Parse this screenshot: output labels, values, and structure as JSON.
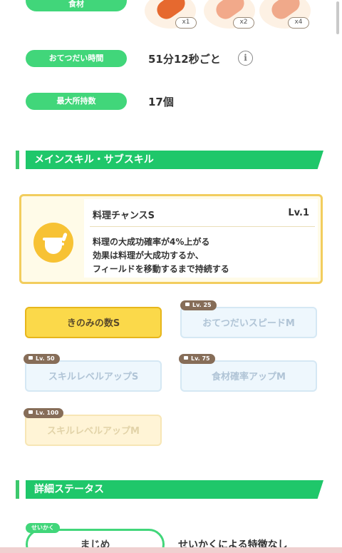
{
  "ingredients": {
    "label": "食材",
    "items": [
      {
        "icon": "sausage-icon",
        "count": "x1",
        "color": "#e6692f"
      },
      {
        "icon": "sausage-icon",
        "count": "x2",
        "color": "#f2a98a"
      },
      {
        "icon": "sausage-icon",
        "count": "x4",
        "color": "#f0a98a"
      }
    ]
  },
  "stats": {
    "help_interval_label": "おてつだい時間",
    "help_interval_value": "51分12秒ごと",
    "max_carry_label": "最大所持数",
    "max_carry_value": "17個"
  },
  "main_skill_section": {
    "title": "メインスキル・サブスキル"
  },
  "main_skill": {
    "icon": "cooking-pot-icon",
    "name": "料理チャンスS",
    "level": "Lv.1",
    "description_lines": [
      "料理の大成功確率が4%上がる",
      "効果は料理が大成功するか、",
      "フィールドを移動するまで持続する"
    ]
  },
  "sub_skills": [
    {
      "label": "きのみの数S",
      "lock": "",
      "state": "active"
    },
    {
      "label": "おてつだいスピードM",
      "lock": "Lv. 25",
      "state": "locked"
    },
    {
      "label": "スキルレベルアップS",
      "lock": "Lv. 50",
      "state": "locked"
    },
    {
      "label": "食材確率アップM",
      "lock": "Lv. 75",
      "state": "locked"
    },
    {
      "label": "スキルレベルアップM",
      "lock": "Lv. 100",
      "state": "locked-gold"
    }
  ],
  "detail_section": {
    "title": "詳細ステータス"
  },
  "nature": {
    "tag": "せいかく",
    "value": "まじめ",
    "effect": "せいかくによる特徴なし"
  },
  "colors": {
    "accent_green": "#1fc76a",
    "skill_yellow": "#f7c234",
    "lock_brown": "#866d58"
  }
}
